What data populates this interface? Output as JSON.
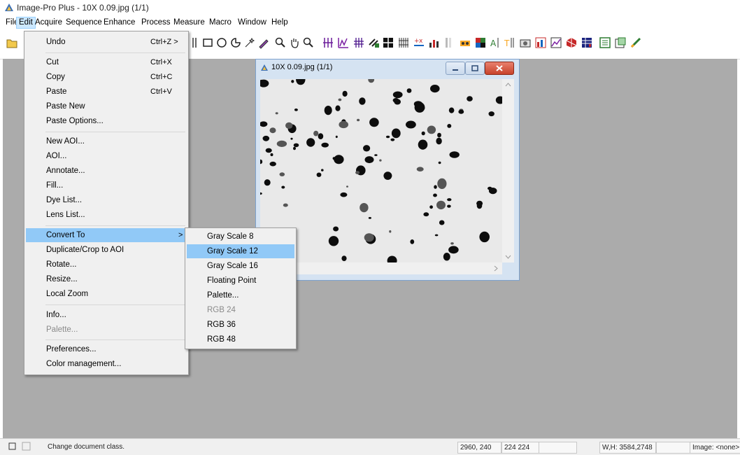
{
  "titlebar": {
    "title": "Image-Pro Plus - 10X 0.09.jpg (1/1)"
  },
  "menubar": [
    "File",
    "Edit",
    "Acquire",
    "Sequence",
    "Enhance",
    "Process",
    "Measure",
    "Macro",
    "Window",
    "Help"
  ],
  "edit_menu": {
    "items": [
      {
        "label": "Undo",
        "shortcut": "Ctrl+Z >"
      },
      {
        "label": "Cut",
        "shortcut": "Ctrl+X"
      },
      {
        "label": "Copy",
        "shortcut": "Ctrl+C"
      },
      {
        "label": "Paste",
        "shortcut": "Ctrl+V"
      },
      {
        "label": "Paste New",
        "shortcut": ""
      },
      {
        "label": "Paste Options...",
        "shortcut": ""
      },
      {
        "label": "New AOI...",
        "shortcut": ""
      },
      {
        "label": "AOI...",
        "shortcut": ""
      },
      {
        "label": "Annotate...",
        "shortcut": ""
      },
      {
        "label": "Fill...",
        "shortcut": ""
      },
      {
        "label": "Dye List...",
        "shortcut": ""
      },
      {
        "label": "Lens List...",
        "shortcut": ""
      },
      {
        "label": "Convert To",
        "shortcut": ">"
      },
      {
        "label": "Duplicate/Crop to AOI",
        "shortcut": ""
      },
      {
        "label": "Rotate...",
        "shortcut": ""
      },
      {
        "label": "Resize...",
        "shortcut": ""
      },
      {
        "label": "Local Zoom",
        "shortcut": ""
      },
      {
        "label": "Info...",
        "shortcut": ""
      },
      {
        "label": "Palette...",
        "shortcut": ""
      },
      {
        "label": "Preferences...",
        "shortcut": ""
      },
      {
        "label": "Color management...",
        "shortcut": ""
      }
    ]
  },
  "convert_submenu": {
    "items": [
      "Gray Scale 8",
      "Gray Scale 12",
      "Gray Scale 16",
      "Floating Point",
      "Palette...",
      "RGB 24",
      "RGB 36",
      "RGB 48"
    ]
  },
  "document_window": {
    "title": "10X 0.09.jpg (1/1)"
  },
  "statusbar": {
    "message": "Change document class.",
    "coords": "2960, 240",
    "value": "224 224",
    "wh": "W,H: 3584,2748",
    "image": "Image: <none>"
  }
}
